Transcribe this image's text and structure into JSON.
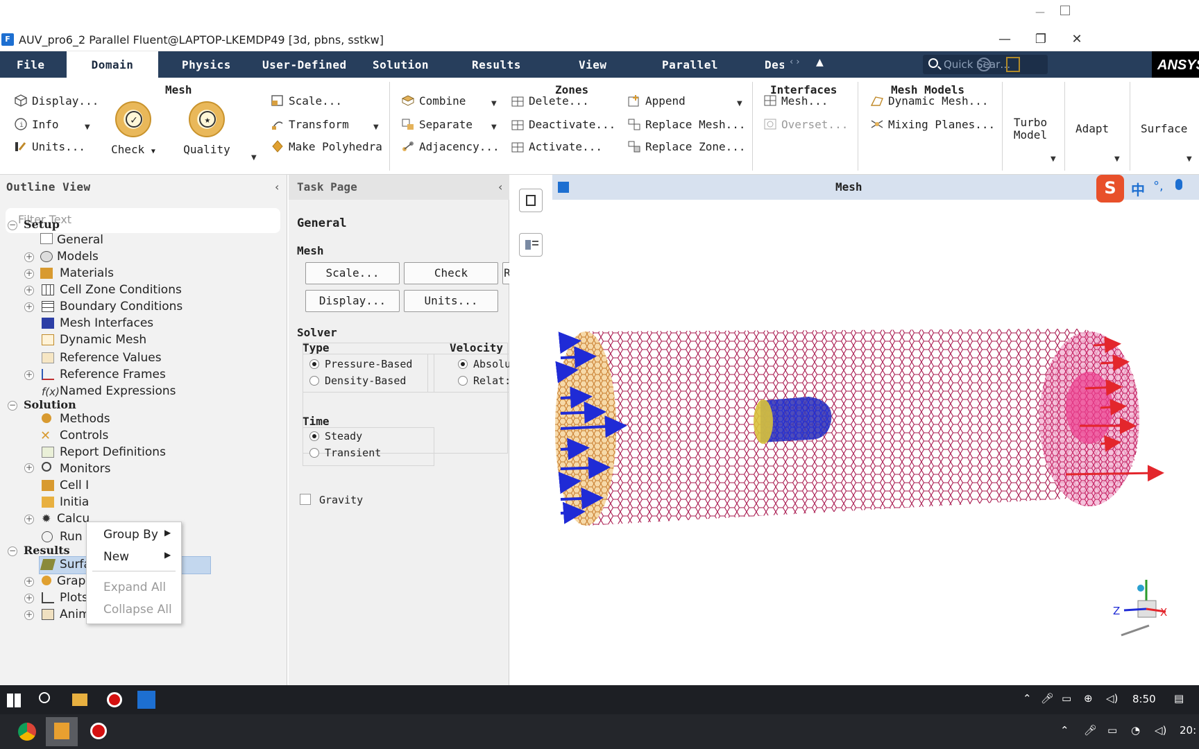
{
  "window": {
    "title": "AUV_pro6_2 Parallel Fluent@LAPTOP-LKEMDP49  [3d, pbns, sstkw]",
    "controls": [
      "—",
      "❐",
      "✕"
    ]
  },
  "menu": {
    "tabs": [
      "File",
      "Domain",
      "Physics",
      "User-Defined",
      "Solution",
      "Results",
      "View",
      "Parallel",
      "Des"
    ],
    "active": "Domain",
    "search_placeholder": "Quick Sear…",
    "brand": "ANSYS"
  },
  "ribbon": {
    "mesh": {
      "title": "Mesh",
      "display": "Display...",
      "info": "Info",
      "units": "Units...",
      "check": "Check",
      "quality": "Quality",
      "scale": "Scale...",
      "transform": "Transform",
      "make_polyhedra": "Make Polyhedra"
    },
    "zones": {
      "title": "Zones",
      "combine": "Combine",
      "separate": "Separate",
      "adjacency": "Adjacency...",
      "delete": "Delete...",
      "deactivate": "Deactivate...",
      "activate": "Activate...",
      "append": "Append",
      "replace_mesh": "Replace Mesh...",
      "replace_zone": "Replace Zone..."
    },
    "interfaces": {
      "title": "Interfaces",
      "mesh": "Mesh...",
      "overset": "Overset..."
    },
    "mesh_models": {
      "title": "Mesh Models",
      "dynamic_mesh": "Dynamic Mesh...",
      "mixing_planes": "Mixing Planes..."
    },
    "turbo_model": "Turbo Model",
    "adapt": "Adapt",
    "surface": "Surface"
  },
  "outline": {
    "title": "Outline View",
    "filter_placeholder": "Filter Text",
    "setup": "Setup",
    "setup_items": [
      "General",
      "Models",
      "Materials",
      "Cell Zone Conditions",
      "Boundary Conditions",
      "Mesh Interfaces",
      "Dynamic Mesh",
      "Reference Values",
      "Reference Frames",
      "Named Expressions"
    ],
    "solution": "Solution",
    "solution_items": [
      "Methods",
      "Controls",
      "Report Definitions",
      "Monitors",
      "Cell I",
      "Initia",
      "Calcu",
      "Run"
    ],
    "results": "Results",
    "results_items": [
      "Surfaces",
      "Graphics",
      "Plots",
      "Animations"
    ]
  },
  "context_menu": {
    "items": [
      "Group By",
      "New",
      "Expand All",
      "Collapse All"
    ]
  },
  "task_page": {
    "title": "Task Page",
    "heading": "General",
    "mesh_label": "Mesh",
    "scale_btn": "Scale...",
    "check_btn": "Check",
    "report_btn": "R",
    "display_btn": "Display...",
    "units_btn": "Units...",
    "solver_label": "Solver",
    "type_label": "Type",
    "pressure_based": "Pressure-Based",
    "density_based": "Density-Based",
    "velocity_label": "Velocity",
    "absolute": "Absolu",
    "relative": "Relat:",
    "time_label": "Time",
    "steady": "Steady",
    "transient": "Transient",
    "gravity": "Gravity"
  },
  "graphics": {
    "title": "Mesh",
    "ime": [
      "中",
      "°,"
    ],
    "axis_labels": {
      "z": "Z",
      "x": "X"
    },
    "colors": {
      "mesh_body": "#a8184e",
      "inlet": "#d9a05a",
      "outlet": "#e8348a",
      "auv": "#3a3ab5",
      "arrows_in": "#1f2bd6",
      "arrows_out": "#e3262c"
    }
  },
  "taskbar": {
    "clock": "8:50",
    "clock2": "20:"
  }
}
